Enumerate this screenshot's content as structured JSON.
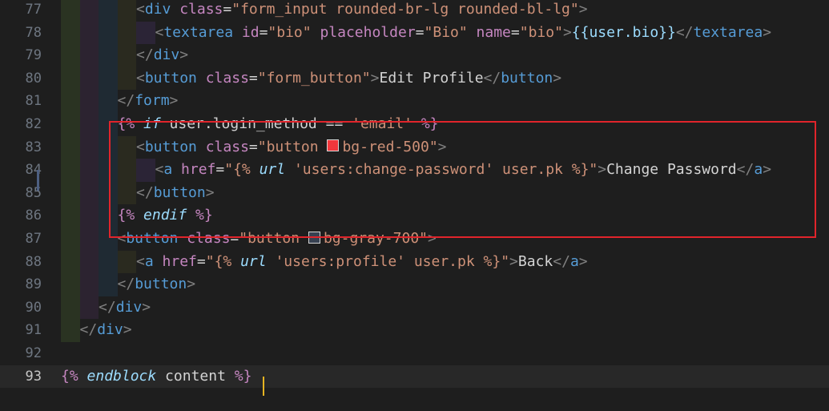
{
  "editor": {
    "lines": [
      {
        "no": "77",
        "indent": 4,
        "tokens": [
          [
            "br",
            "<"
          ],
          [
            "tag",
            "div"
          ],
          [
            "txt",
            " "
          ],
          [
            "attr",
            "class"
          ],
          [
            "eq",
            "="
          ],
          [
            "str",
            "\"form_input rounded-br-lg rounded-bl-lg\""
          ],
          [
            "br",
            ">"
          ]
        ]
      },
      {
        "no": "78",
        "indent": 5,
        "tokens": [
          [
            "br",
            "<"
          ],
          [
            "tag",
            "textarea"
          ],
          [
            "txt",
            " "
          ],
          [
            "attr",
            "id"
          ],
          [
            "eq",
            "="
          ],
          [
            "str",
            "\"bio\""
          ],
          [
            "txt",
            " "
          ],
          [
            "attr",
            "placeholder"
          ],
          [
            "eq",
            "="
          ],
          [
            "str",
            "\"Bio\""
          ],
          [
            "txt",
            " "
          ],
          [
            "attr",
            "name"
          ],
          [
            "eq",
            "="
          ],
          [
            "str",
            "\"bio\""
          ],
          [
            "br",
            ">"
          ],
          [
            "var",
            "{{user.bio}}"
          ],
          [
            "br",
            "</"
          ],
          [
            "tag",
            "textarea"
          ],
          [
            "br",
            ">"
          ]
        ]
      },
      {
        "no": "79",
        "indent": 4,
        "tokens": [
          [
            "br",
            "</"
          ],
          [
            "tag",
            "div"
          ],
          [
            "br",
            ">"
          ]
        ]
      },
      {
        "no": "80",
        "indent": 4,
        "tokens": [
          [
            "br",
            "<"
          ],
          [
            "tag",
            "button"
          ],
          [
            "txt",
            " "
          ],
          [
            "attr",
            "class"
          ],
          [
            "eq",
            "="
          ],
          [
            "str",
            "\"form_button\""
          ],
          [
            "br",
            ">"
          ],
          [
            "txt",
            "Edit Profile"
          ],
          [
            "br",
            "</"
          ],
          [
            "tag",
            "button"
          ],
          [
            "br",
            ">"
          ]
        ]
      },
      {
        "no": "81",
        "indent": 3,
        "tokens": [
          [
            "br",
            "</"
          ],
          [
            "tag",
            "form"
          ],
          [
            "br",
            ">"
          ]
        ]
      },
      {
        "no": "82",
        "indent": 3,
        "tokens": [
          [
            "tpl",
            "{% "
          ],
          [
            "ital",
            "if"
          ],
          [
            "txt",
            " user.login_method == "
          ],
          [
            "str",
            "'email'"
          ],
          [
            "tpl",
            " %}"
          ]
        ]
      },
      {
        "no": "83",
        "indent": 4,
        "tokens": [
          [
            "br",
            "<"
          ],
          [
            "tag",
            "button"
          ],
          [
            "txt",
            " "
          ],
          [
            "attr",
            "class"
          ],
          [
            "eq",
            "="
          ],
          [
            "str",
            "\"button "
          ],
          [
            "swatch",
            "#f2373c"
          ],
          [
            "str",
            "bg-red-500\""
          ],
          [
            "br",
            ">"
          ]
        ]
      },
      {
        "no": "84",
        "indent": 5,
        "tokens": [
          [
            "br",
            "<"
          ],
          [
            "tag",
            "a"
          ],
          [
            "txt",
            " "
          ],
          [
            "attr",
            "href"
          ],
          [
            "eq",
            "="
          ],
          [
            "str",
            "\"{% "
          ],
          [
            "ital",
            "url"
          ],
          [
            "str",
            " 'users:change-password' user.pk %}\""
          ],
          [
            "br",
            ">"
          ],
          [
            "txt",
            "Change Password"
          ],
          [
            "br",
            "</"
          ],
          [
            "tag",
            "a"
          ],
          [
            "br",
            ">"
          ]
        ]
      },
      {
        "no": "85",
        "indent": 4,
        "tokens": [
          [
            "br",
            "</"
          ],
          [
            "tag",
            "button"
          ],
          [
            "br",
            ">"
          ]
        ]
      },
      {
        "no": "86",
        "indent": 3,
        "tokens": [
          [
            "tpl",
            "{% "
          ],
          [
            "ital",
            "endif"
          ],
          [
            "tpl",
            " %}"
          ]
        ]
      },
      {
        "no": "87",
        "indent": 3,
        "tokens": [
          [
            "br",
            "<"
          ],
          [
            "tag",
            "button"
          ],
          [
            "txt",
            " "
          ],
          [
            "attr",
            "class"
          ],
          [
            "eq",
            "="
          ],
          [
            "str",
            "\"button "
          ],
          [
            "swatch",
            "#374151"
          ],
          [
            "str",
            "bg-gray-700\""
          ],
          [
            "br",
            ">"
          ]
        ]
      },
      {
        "no": "88",
        "indent": 4,
        "tokens": [
          [
            "br",
            "<"
          ],
          [
            "tag",
            "a"
          ],
          [
            "txt",
            " "
          ],
          [
            "attr",
            "href"
          ],
          [
            "eq",
            "="
          ],
          [
            "str",
            "\"{% "
          ],
          [
            "ital",
            "url"
          ],
          [
            "str",
            " 'users:profile' user.pk %}\""
          ],
          [
            "br",
            ">"
          ],
          [
            "txt",
            "Back"
          ],
          [
            "br",
            "</"
          ],
          [
            "tag",
            "a"
          ],
          [
            "br",
            ">"
          ]
        ]
      },
      {
        "no": "89",
        "indent": 3,
        "tokens": [
          [
            "br",
            "</"
          ],
          [
            "tag",
            "button"
          ],
          [
            "br",
            ">"
          ]
        ]
      },
      {
        "no": "90",
        "indent": 2,
        "tokens": [
          [
            "br",
            "</"
          ],
          [
            "tag",
            "div"
          ],
          [
            "br",
            ">"
          ]
        ]
      },
      {
        "no": "91",
        "indent": 1,
        "tokens": [
          [
            "br",
            "</"
          ],
          [
            "tag",
            "div"
          ],
          [
            "br",
            ">"
          ]
        ]
      },
      {
        "no": "92",
        "indent": 0,
        "tokens": []
      },
      {
        "no": "93",
        "indent": 0,
        "current": true,
        "tokens": [
          [
            "tpl",
            "{% "
          ],
          [
            "ital",
            "endblock"
          ],
          [
            "txt",
            " content "
          ],
          [
            "tpl",
            "%}"
          ]
        ]
      }
    ],
    "colors": {
      "background": "#1e1e1e",
      "highlight_border": "#e0242b",
      "cursor": "#e6b422"
    }
  }
}
